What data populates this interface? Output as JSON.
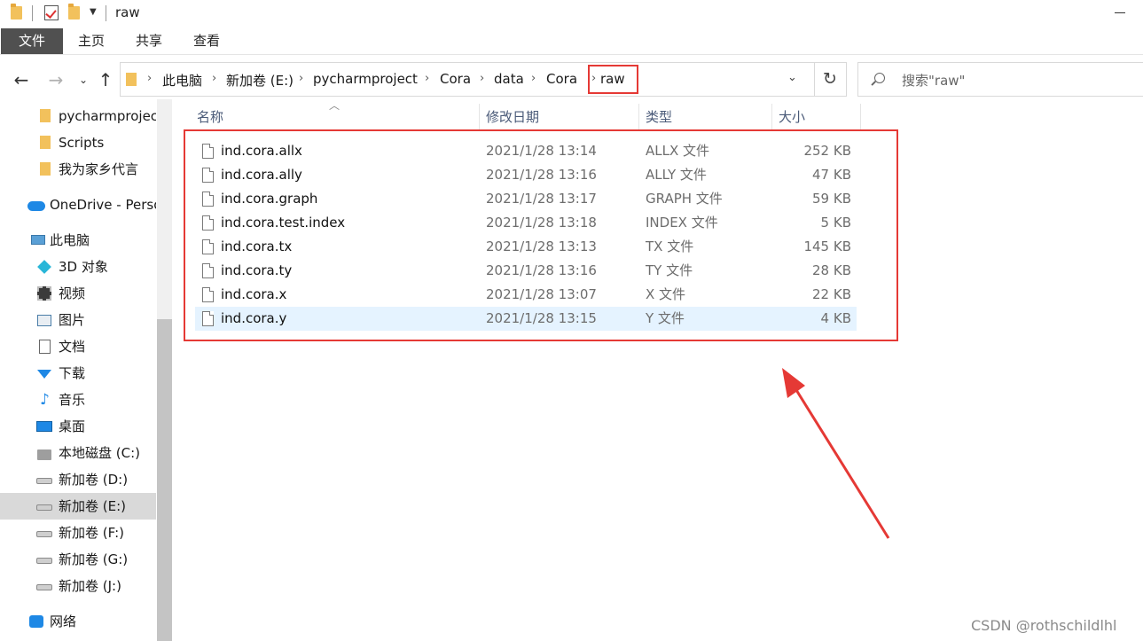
{
  "window": {
    "title": "raw"
  },
  "ribbon": {
    "tabs": [
      "文件",
      "主页",
      "共享",
      "查看"
    ]
  },
  "nav": {
    "back": "←",
    "forward": "→",
    "recent": "⌄",
    "up": "↑"
  },
  "address": {
    "crumbs": [
      "此电脑",
      "新加卷 (E:)",
      "pycharmproject",
      "Cora",
      "data",
      "Cora",
      "raw"
    ],
    "dropdown": "⌄",
    "refresh": "↻"
  },
  "search": {
    "placeholder": "搜索\"raw\""
  },
  "sidebar": {
    "items": [
      {
        "label": "pycharmproject",
        "icon": "folder-icon"
      },
      {
        "label": "Scripts",
        "icon": "folder-icon"
      },
      {
        "label": "我为家乡代言",
        "icon": "folder-icon"
      },
      {
        "label": "OneDrive - Personal",
        "icon": "cloud-icon"
      },
      {
        "label": "此电脑",
        "icon": "computer-icon"
      },
      {
        "label": "3D 对象",
        "icon": "cube-icon"
      },
      {
        "label": "视频",
        "icon": "video-icon"
      },
      {
        "label": "图片",
        "icon": "pictures-icon"
      },
      {
        "label": "文档",
        "icon": "document-icon"
      },
      {
        "label": "下载",
        "icon": "download-icon"
      },
      {
        "label": "音乐",
        "icon": "music-icon"
      },
      {
        "label": "桌面",
        "icon": "desktop-icon"
      },
      {
        "label": "本地磁盘 (C:)",
        "icon": "windows-drive-icon"
      },
      {
        "label": "新加卷 (D:)",
        "icon": "drive-icon"
      },
      {
        "label": "新加卷 (E:)",
        "icon": "drive-icon",
        "selected": true
      },
      {
        "label": "新加卷 (F:)",
        "icon": "drive-icon"
      },
      {
        "label": "新加卷 (G:)",
        "icon": "drive-icon"
      },
      {
        "label": "新加卷 (J:)",
        "icon": "drive-icon"
      },
      {
        "label": "网络",
        "icon": "network-icon"
      }
    ]
  },
  "columns": {
    "name": "名称",
    "date": "修改日期",
    "type": "类型",
    "size": "大小"
  },
  "files": [
    {
      "name": "ind.cora.allx",
      "date": "2021/1/28 13:14",
      "type": "ALLX 文件",
      "size": "252 KB"
    },
    {
      "name": "ind.cora.ally",
      "date": "2021/1/28 13:16",
      "type": "ALLY 文件",
      "size": "47 KB"
    },
    {
      "name": "ind.cora.graph",
      "date": "2021/1/28 13:17",
      "type": "GRAPH 文件",
      "size": "59 KB"
    },
    {
      "name": "ind.cora.test.index",
      "date": "2021/1/28 13:18",
      "type": "INDEX 文件",
      "size": "5 KB"
    },
    {
      "name": "ind.cora.tx",
      "date": "2021/1/28 13:13",
      "type": "TX 文件",
      "size": "145 KB"
    },
    {
      "name": "ind.cora.ty",
      "date": "2021/1/28 13:16",
      "type": "TY 文件",
      "size": "28 KB"
    },
    {
      "name": "ind.cora.x",
      "date": "2021/1/28 13:07",
      "type": "X 文件",
      "size": "22 KB"
    },
    {
      "name": "ind.cora.y",
      "date": "2021/1/28 13:15",
      "type": "Y 文件",
      "size": "4 KB",
      "selected": true
    }
  ],
  "watermark": "CSDN @rothschildlhl",
  "colors": {
    "highlight": "#e53935",
    "selection": "#e5f3ff",
    "file_tab": "#505050"
  }
}
